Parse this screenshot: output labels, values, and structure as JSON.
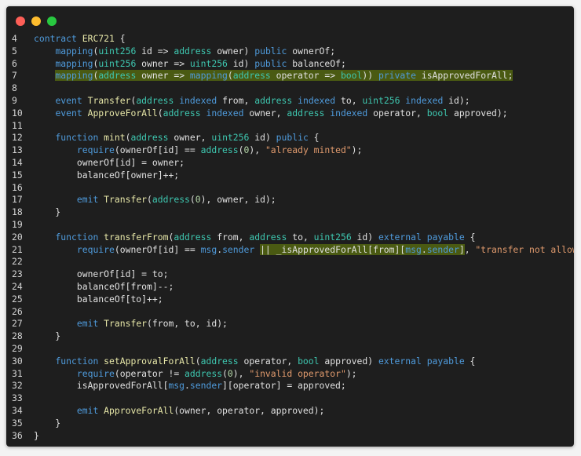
{
  "window": {
    "controls": [
      {
        "name": "close",
        "color": "#fe5f57"
      },
      {
        "name": "minimize",
        "color": "#febc2e"
      },
      {
        "name": "maximize",
        "color": "#28c840"
      }
    ]
  },
  "code": {
    "language": "solidity",
    "lines": [
      {
        "n": "4",
        "text": "contract ERC721 {"
      },
      {
        "n": "5",
        "text": "    mapping(uint256 id => address owner) public ownerOf;"
      },
      {
        "n": "6",
        "text": "    mapping(uint256 owner => uint256 id) public balanceOf;"
      },
      {
        "n": "7",
        "text": "    mapping(address owner => mapping(address operator => bool)) private isApprovedForAll;",
        "highlight": "full"
      },
      {
        "n": "8",
        "text": ""
      },
      {
        "n": "9",
        "text": "    event Transfer(address indexed from, address indexed to, uint256 indexed id);"
      },
      {
        "n": "10",
        "text": "    event ApproveForAll(address indexed owner, address indexed operator, bool approved);"
      },
      {
        "n": "11",
        "text": ""
      },
      {
        "n": "12",
        "text": "    function mint(address owner, uint256 id) public {"
      },
      {
        "n": "13",
        "text": "        require(ownerOf[id] == address(0), \"already minted\");"
      },
      {
        "n": "14",
        "text": "        ownerOf[id] = owner;"
      },
      {
        "n": "15",
        "text": "        balanceOf[owner]++;"
      },
      {
        "n": "16",
        "text": ""
      },
      {
        "n": "17",
        "text": "        emit Transfer(address(0), owner, id);"
      },
      {
        "n": "18",
        "text": "    }"
      },
      {
        "n": "19",
        "text": ""
      },
      {
        "n": "20",
        "text": "    function transferFrom(address from, address to, uint256 id) external payable {"
      },
      {
        "n": "21",
        "text": "        require(ownerOf[id] == msg.sender || _isApprovedForAll[from][msg.sender], \"transfer not allowed\");",
        "highlight": "partial"
      },
      {
        "n": "22",
        "text": ""
      },
      {
        "n": "23",
        "text": "        ownerOf[id] = to;"
      },
      {
        "n": "24",
        "text": "        balanceOf[from]--;"
      },
      {
        "n": "25",
        "text": "        balanceOf[to]++;"
      },
      {
        "n": "26",
        "text": ""
      },
      {
        "n": "27",
        "text": "        emit Transfer(from, to, id);"
      },
      {
        "n": "28",
        "text": "    }"
      },
      {
        "n": "29",
        "text": ""
      },
      {
        "n": "30",
        "text": "    function setApprovalForAll(address operator, bool approved) external payable {"
      },
      {
        "n": "31",
        "text": "        require(operator != address(0), \"invalid operator\");"
      },
      {
        "n": "32",
        "text": "        isApprovedForAll[msg.sender][operator] = approved;"
      },
      {
        "n": "33",
        "text": ""
      },
      {
        "n": "34",
        "text": "        emit ApproveForAll(owner, operator, approved);"
      },
      {
        "n": "35",
        "text": "    }"
      },
      {
        "n": "36",
        "text": "}"
      }
    ]
  },
  "colors": {
    "background": "#1e1e1e",
    "keyword": "#4f9bdc",
    "type": "#3ec7b0",
    "function": "#e7e7a8",
    "string": "#e09a6d",
    "number": "#b5d7a8",
    "highlight": "#4a5a12"
  }
}
